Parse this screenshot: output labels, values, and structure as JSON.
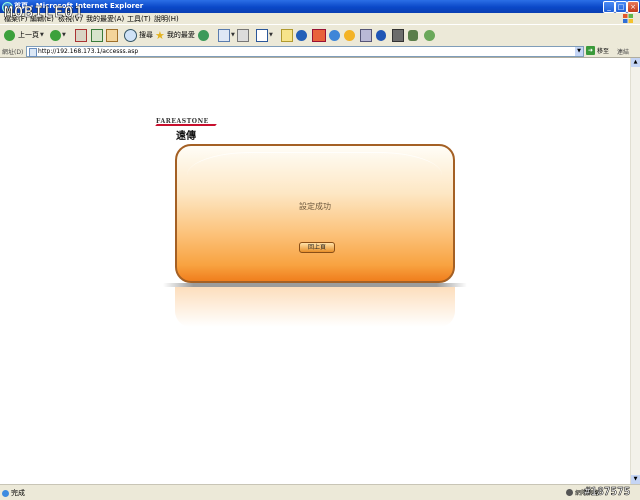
{
  "window": {
    "title": "首頁 - Microsoft Internet Explorer",
    "watermark": "MOBILE01",
    "controls": {
      "minimize": "_",
      "maximize": "□",
      "close": "×"
    }
  },
  "menubar": {
    "items": [
      "檔案(F)",
      "編輯(E)",
      "檢視(V)",
      "我的最愛(A)",
      "工具(T)",
      "說明(H)"
    ]
  },
  "toolbar": {
    "back_label": "上一頁",
    "search_label": "搜尋",
    "favorites_label": "我的最愛"
  },
  "address": {
    "label": "網址(D)",
    "url": "http://192.168.173.1/accesss.asp",
    "go_label": "移至",
    "links_label": "連結"
  },
  "brand": {
    "logo_text": "FAREASTONE",
    "logo_cn": "遠傳"
  },
  "panel": {
    "message": "設定成功",
    "button_label": "回上頁"
  },
  "statusbar": {
    "status": "完成",
    "zone": "網際網路"
  },
  "watermark_id": "#187575",
  "colors": {
    "titlebar": "#0a48c8",
    "panel_orange": "#f8a341",
    "chrome": "#ece9d8",
    "brand_red": "#c8102e"
  }
}
